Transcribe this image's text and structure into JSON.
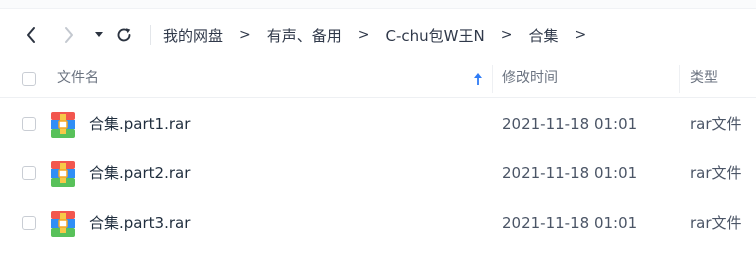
{
  "breadcrumbs": [
    "我的网盘",
    "有声、备用",
    "C-chu包W王N",
    "合集"
  ],
  "breadcrumb_separator": ">",
  "header": {
    "name": "文件名",
    "modified": "修改时间",
    "type": "类型"
  },
  "files": [
    {
      "name": "合集.part1.rar",
      "modified": "2021-11-18 01:01",
      "type": "rar文件"
    },
    {
      "name": "合集.part2.rar",
      "modified": "2021-11-18 01:01",
      "type": "rar文件"
    },
    {
      "name": "合集.part3.rar",
      "modified": "2021-11-18 01:01",
      "type": "rar文件"
    }
  ],
  "colors": {
    "sort_arrow": "#2f7cf6",
    "archive_top": "#f2564e",
    "archive_mid": "#2f8ef6",
    "archive_bottom": "#58c15a",
    "archive_clasp": "#f5a623"
  },
  "icons": {
    "back": "chevron-left-icon",
    "forward": "chevron-right-icon",
    "dropdown": "caret-down-icon",
    "refresh": "refresh-icon",
    "sort": "sort-up-icon",
    "file": "rar-archive-icon"
  }
}
